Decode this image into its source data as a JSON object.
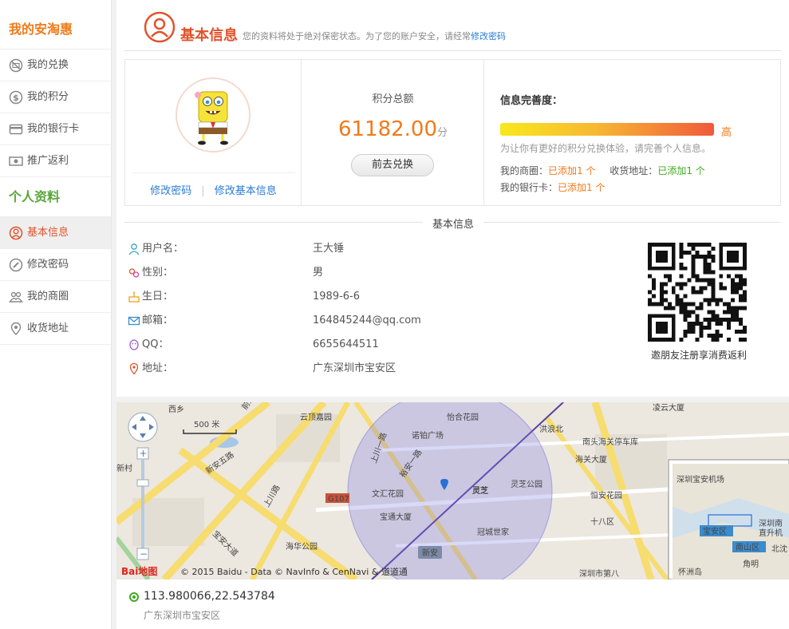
{
  "sidebar": {
    "section1_title": "我的安淘惠",
    "items1": [
      {
        "label": "我的兑换",
        "icon": "no-cash-icon"
      },
      {
        "label": "我的积分",
        "icon": "dollar-coin-icon"
      },
      {
        "label": "我的银行卡",
        "icon": "bank-card-icon"
      },
      {
        "label": "推广返利",
        "icon": "money-bill-icon"
      }
    ],
    "section2_title": "个人资料",
    "items2": [
      {
        "label": "基本信息",
        "icon": "user-circle-icon",
        "active": true
      },
      {
        "label": "修改密码",
        "icon": "pencil-icon"
      },
      {
        "label": "我的商圈",
        "icon": "people-group-icon"
      },
      {
        "label": "收货地址",
        "icon": "location-pin-icon"
      }
    ]
  },
  "header": {
    "title": "基本信息",
    "desc": "您的资料将处于绝对保密状态。为了您的账户安全，请经常",
    "link": "修改密码"
  },
  "profile": {
    "links": [
      "修改密码",
      "修改基本信息"
    ]
  },
  "points": {
    "label": "积分总额",
    "value": "61182.00",
    "unit": "分",
    "button": "前去兑换"
  },
  "completeness": {
    "title": "信息完善度：",
    "level": "高",
    "fill_fraction": 1.0,
    "tip": "为让你有更好的积分兑换体验，请完善个人信息。",
    "circle_label": "我的商圈：",
    "circle_value": "已添加1 个",
    "address_label": "收货地址：",
    "address_value": "已添加1 个",
    "card_label": "我的银行卡：",
    "card_value": "已添加1 个"
  },
  "basic": {
    "section_label": "基本信息",
    "fields": [
      {
        "label": "用户名：",
        "value": "王大锤",
        "icon": "user-icon"
      },
      {
        "label": "性别：",
        "value": "男",
        "icon": "gender-icon"
      },
      {
        "label": "生日：",
        "value": "1989-6-6",
        "icon": "cake-icon"
      },
      {
        "label": "邮箱：",
        "value": "164845244@qq.com",
        "icon": "mail-icon"
      },
      {
        "label": "QQ：",
        "value": "6655644511",
        "icon": "qq-penguin-icon"
      },
      {
        "label": "地址：",
        "value": "广东深圳市宝安区",
        "icon": "location-pin-icon"
      }
    ],
    "qr_caption": "邀朋友注册享消费返利"
  },
  "map": {
    "scale": "500 米",
    "copyright": "© 2015 Baidu - Data © NavInfo & CenNavi & 道道通",
    "logo": "Bai地图",
    "labels": [
      "西乡",
      "云顶嘉园",
      "怡合花园",
      "洪浪北",
      "凌云大厦",
      "诺铂广场",
      "南头海关停车库",
      "新安五路",
      "上川路",
      "海关大厦",
      "文汇花园",
      "灵芝",
      "灵芝公园",
      "恒安花园",
      "宝通大厦",
      "冠城世家",
      "十八区",
      "新村",
      "海华公园",
      "新安",
      "深圳市第八",
      "宝安大道",
      "G107",
      "前进路",
      "裕安一路",
      "上川一路"
    ],
    "inset_labels": [
      "深圳宝安机场",
      "宝安区",
      "南山区",
      "深圳南",
      "直升机",
      "北沈",
      "角明",
      "怀洲岛"
    ]
  },
  "location": {
    "coords": "113.980066,22.543784",
    "address": "广东深圳市宝安区"
  }
}
